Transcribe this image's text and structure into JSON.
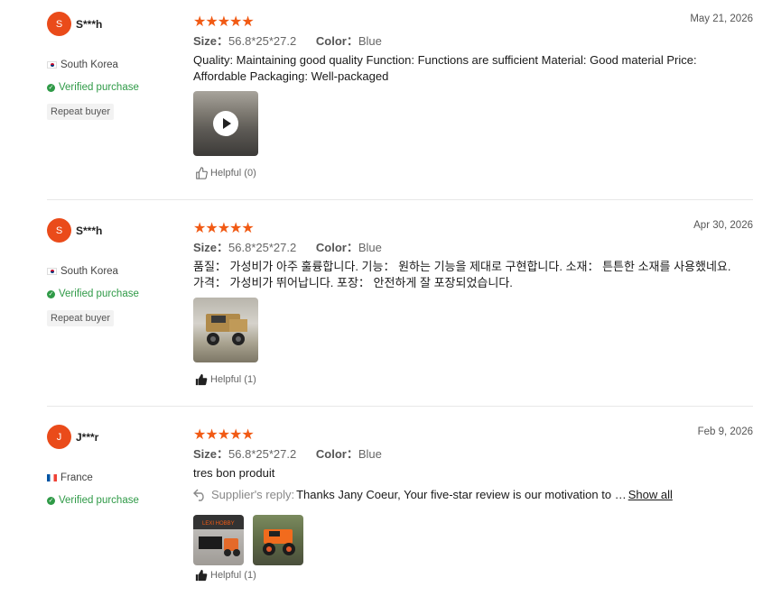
{
  "colors": {
    "accent": "#f15a14",
    "verified": "#2f9a47",
    "avatar": "#ea4b1a"
  },
  "reviews": [
    {
      "avatar_letter": "S",
      "username": "S***h",
      "country": "South Korea",
      "verified": "Verified purchase",
      "repeat": "Repeat buyer",
      "stars": "★★★★★",
      "date": "May 21, 2026",
      "size_label": "Size：",
      "size_value": "56.8*25*27.2",
      "color_label": "Color：",
      "color_value": "Blue",
      "text": "Quality: Maintaining good quality Function: Functions are sufficient Material: Good material Price: Affordable Packaging: Well-packaged",
      "helpful": "Helpful (0)"
    },
    {
      "avatar_letter": "S",
      "username": "S***h",
      "country": "South Korea",
      "verified": "Verified purchase",
      "repeat": "Repeat buyer",
      "stars": "★★★★★",
      "date": "Apr 30, 2026",
      "size_label": "Size：",
      "size_value": "56.8*25*27.2",
      "color_label": "Color：",
      "color_value": "Blue",
      "text": "품질： 가성비가 아주 훌륭합니다. 기능： 원하는 기능을 제대로 구현합니다. 소재： 튼튼한 소재를 사용했네요. 가격： 가성비가 뛰어납니다. 포장： 안전하게 잘 포장되었습니다.",
      "helpful": "Helpful (1)"
    },
    {
      "avatar_letter": "J",
      "username": "J***r",
      "country": "France",
      "verified": "Verified purchase",
      "stars": "★★★★★",
      "date": "Feb 9, 2026",
      "size_label": "Size：",
      "size_value": "56.8*25*27.2",
      "color_label": "Color：",
      "color_value": "Blue",
      "text": "tres bon produit",
      "reply_label": "Supplier's reply:",
      "reply_text": "Thanks Jany Coeur, Your five-star review is our motivation to …",
      "show_all": "Show all",
      "thumb_logo": "LEXI HOBBY",
      "helpful": "Helpful (1)"
    }
  ]
}
